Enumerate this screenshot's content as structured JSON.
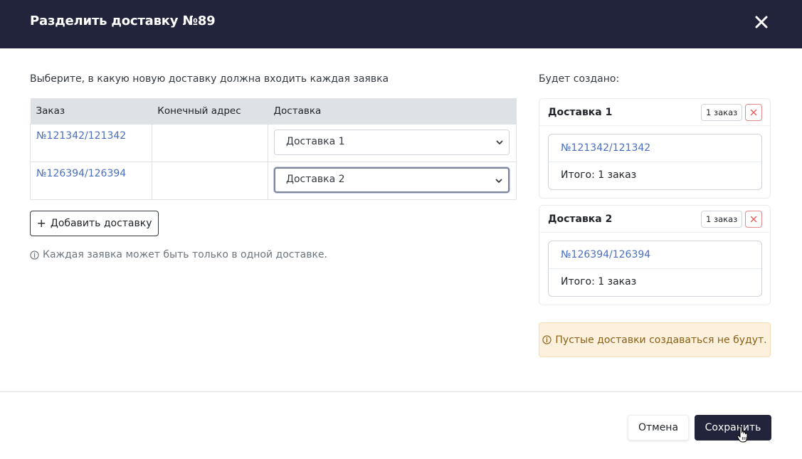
{
  "modal": {
    "title": "Разделить доставку №89",
    "close_icon": "close-icon"
  },
  "left": {
    "instruction": "Выберите, в какую новую доставку должна входить каждая заявка",
    "table": {
      "headers": [
        "Заказ",
        "Конечный адрес",
        "Доставка"
      ],
      "rows": [
        {
          "order": "№121342/121342",
          "address": "",
          "delivery": "Доставка 1"
        },
        {
          "order": "№126394/126394",
          "address": "",
          "delivery": "Доставка 2"
        }
      ]
    },
    "add_button": "Добавить доставку",
    "add_icon": "plus-icon",
    "note": "Каждая заявка может быть только в одной доставке.",
    "note_icon": "info-icon"
  },
  "right": {
    "title": "Будет создано:",
    "deliveries": [
      {
        "name": "Доставка 1",
        "badge": "1 заказ",
        "order": "№121342/121342",
        "total": "Итого: 1 заказ"
      },
      {
        "name": "Доставка 2",
        "badge": "1 заказ",
        "order": "№126394/126394",
        "total": "Итого: 1 заказ"
      }
    ],
    "warning": "Пустые доставки создаваться не будут.",
    "warning_icon": "info-icon"
  },
  "footer": {
    "cancel": "Отмена",
    "save": "Сохранить"
  },
  "colors": {
    "header_bg": "#21243a",
    "link": "#4a6fc0",
    "warning_bg": "#fdf0dc",
    "warning_text": "#8a6016",
    "danger": "#e05c5c"
  }
}
